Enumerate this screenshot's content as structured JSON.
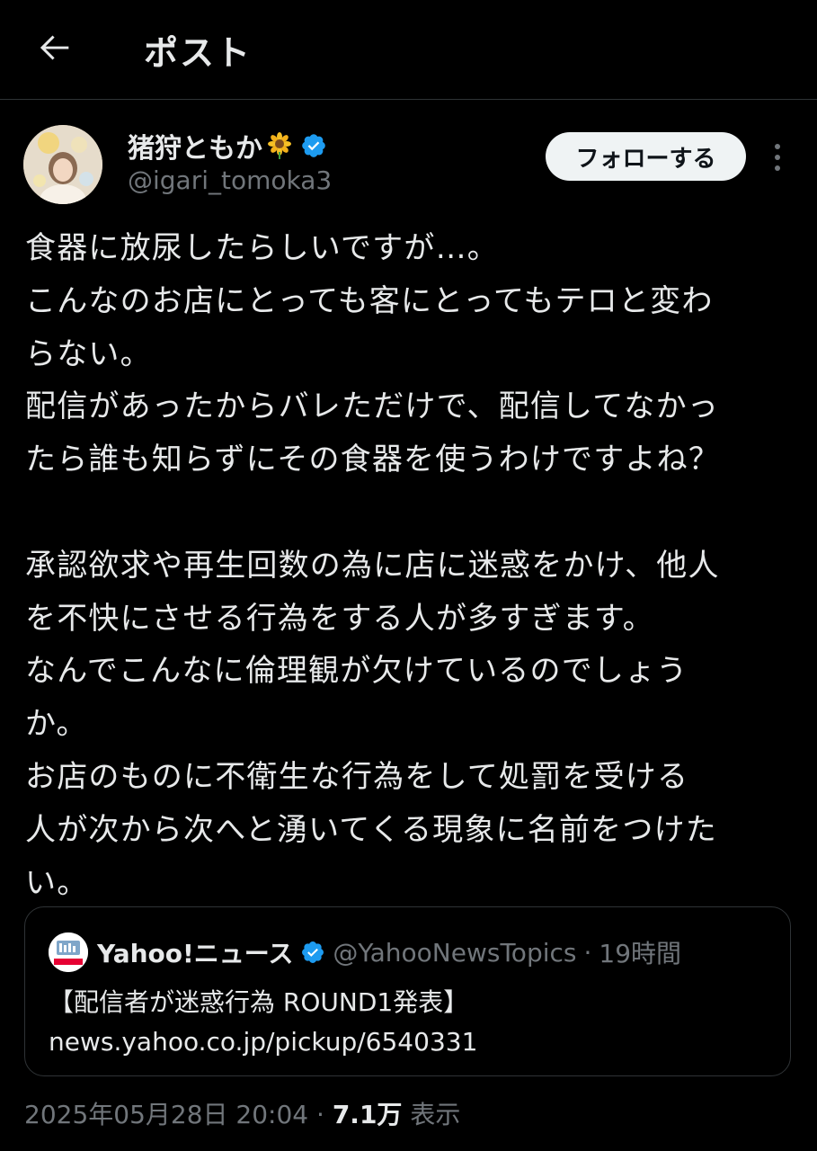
{
  "header": {
    "title": "ポスト",
    "back_icon": "arrow-left-icon"
  },
  "author": {
    "display_name": "猪狩ともか",
    "emoji": "sunflower",
    "verified": true,
    "handle": "@igari_tomoka3",
    "follow_label": "フォローする"
  },
  "tweet": {
    "lines": [
      "食器に放尿したらしいですが…。",
      "こんなのお店にとっても客にとってもテロと変わ",
      "らない。",
      "配信があったからバレただけで、配信してなかっ",
      "たら誰も知らずにその食器を使うわけですよね？",
      "",
      "承認欲求や再生回数の為に店に迷惑をかけ、他人",
      "を不快にさせる行為をする人が多すぎます。",
      "なんでこんなに倫理観が欠けているのでしょう",
      "か。",
      "お店のものに不衛生な行為をして処罰を受ける",
      "人が次から次へと湧いてくる現象に名前をつけた",
      "い。"
    ]
  },
  "quote": {
    "name": "Yahoo!ニュース",
    "verified": true,
    "handle": "@YahooNewsTopics",
    "separator": "·",
    "time": "19時間",
    "title": "【配信者が迷惑行為 ROUND1発表】",
    "url": "news.yahoo.co.jp/pickup/6540331"
  },
  "meta": {
    "timestamp": "2025年05月28日 20:04",
    "separator": "·",
    "views": "7.1万",
    "views_label": "表示"
  },
  "colors": {
    "background": "#000000",
    "text": "#e7e9ea",
    "muted": "#71767b",
    "verified_blue": "#1d9bf0",
    "border": "#2f3336"
  }
}
